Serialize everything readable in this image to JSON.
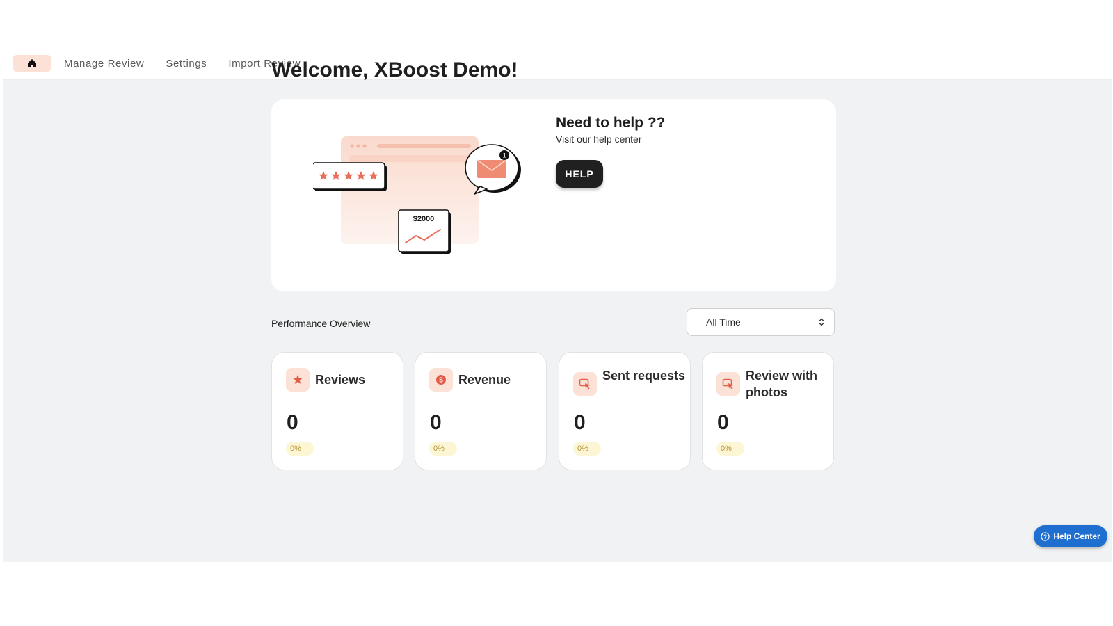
{
  "nav": {
    "home_icon": "home-icon",
    "items": [
      {
        "label": "Manage Review"
      },
      {
        "label": "Settings"
      },
      {
        "label": "Import Review"
      }
    ]
  },
  "welcome_title": "Welcome, XBoost Demo!",
  "help_card": {
    "title": "Need to help ??",
    "subtitle": "Visit our help center",
    "button_label": "HELP",
    "illustration": {
      "amount_label": "$2000",
      "notification_count": "1",
      "rating_stars": 5
    }
  },
  "performance": {
    "title": "Performance Overview",
    "range_selected": "All Time",
    "cards": [
      {
        "title": "Reviews",
        "icon": "star-icon",
        "value": "0",
        "change": "0%"
      },
      {
        "title": "Revenue",
        "icon": "dollar-icon",
        "value": "0",
        "change": "0%"
      },
      {
        "title": "Sent requests",
        "icon": "cursor-click-icon",
        "value": "0",
        "change": "0%"
      },
      {
        "title": "Review with photos",
        "icon": "cursor-click-icon",
        "value": "0",
        "change": "0%"
      }
    ]
  },
  "help_center_button": "Help Center",
  "colors": {
    "accent": "#e8705a",
    "accent_soft": "#fbe1d6",
    "dark_button": "#202020",
    "help_center_blue": "#1f6fd0",
    "badge_bg": "#fdf6d5"
  }
}
